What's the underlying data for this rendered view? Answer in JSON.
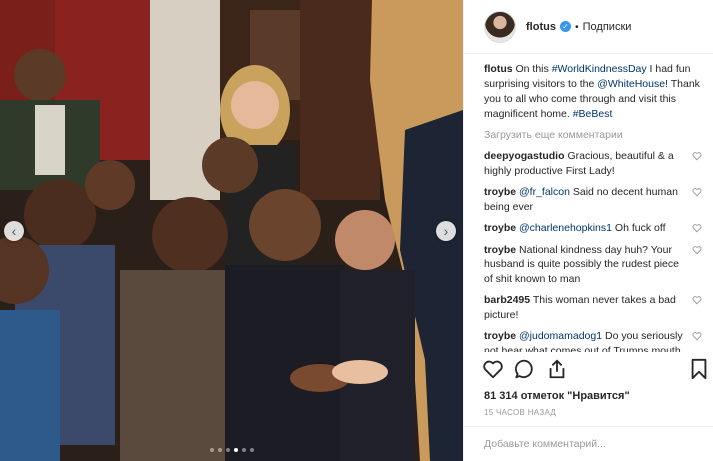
{
  "post": {
    "username": "flotus",
    "separator": "•",
    "follow_label": "Подписки",
    "caption_user": "flotus",
    "caption_parts": [
      {
        "t": " On this ",
        "link": false
      },
      {
        "t": "#WorldKindnessDay",
        "link": true
      },
      {
        "t": " I had fun surprising visitors to the ",
        "link": false
      },
      {
        "t": "@WhiteHouse",
        "link": true
      },
      {
        "t": "! Thank you to all who come through and visit this magnificent home. ",
        "link": false
      },
      {
        "t": "#BeBest",
        "link": true
      }
    ],
    "load_more": "Загрузить еще комментарии",
    "likes": "81 314 отметок \"Нравится\"",
    "time": "15 ЧАСОВ НАЗАД",
    "add_comment_placeholder": "Добавьте комментарий..."
  },
  "comments": [
    {
      "user": "deepyogastudio",
      "mention": "",
      "text": "Gracious, beautiful & a highly productive First Lady!"
    },
    {
      "user": "troybe",
      "mention": "@fr_falcon",
      "text": " Said no decent human being ever"
    },
    {
      "user": "troybe",
      "mention": "@charlenehopkins1",
      "text": " Oh fuck off"
    },
    {
      "user": "troybe",
      "mention": "",
      "text": "National kindness day huh? Your husband is quite possibly the rudest piece of shit known to man"
    },
    {
      "user": "barb2495",
      "mention": "",
      "text": "This woman never takes a bad picture!"
    },
    {
      "user": "troybe",
      "mention": "@judomamadog1",
      "text": " Do you seriously not hear what comes out of Trumps mouth every single fucking"
    }
  ],
  "carousel": {
    "dots": 6,
    "active": 3
  },
  "icons": {
    "verified": "verified-badge-icon",
    "like": "heart-icon",
    "comment": "comment-icon",
    "share": "share-icon",
    "save": "bookmark-icon",
    "prev": "chevron-left-icon",
    "next": "chevron-right-icon"
  },
  "colors": {
    "link": "#003569",
    "verified": "#3897f0",
    "muted": "#999999"
  }
}
